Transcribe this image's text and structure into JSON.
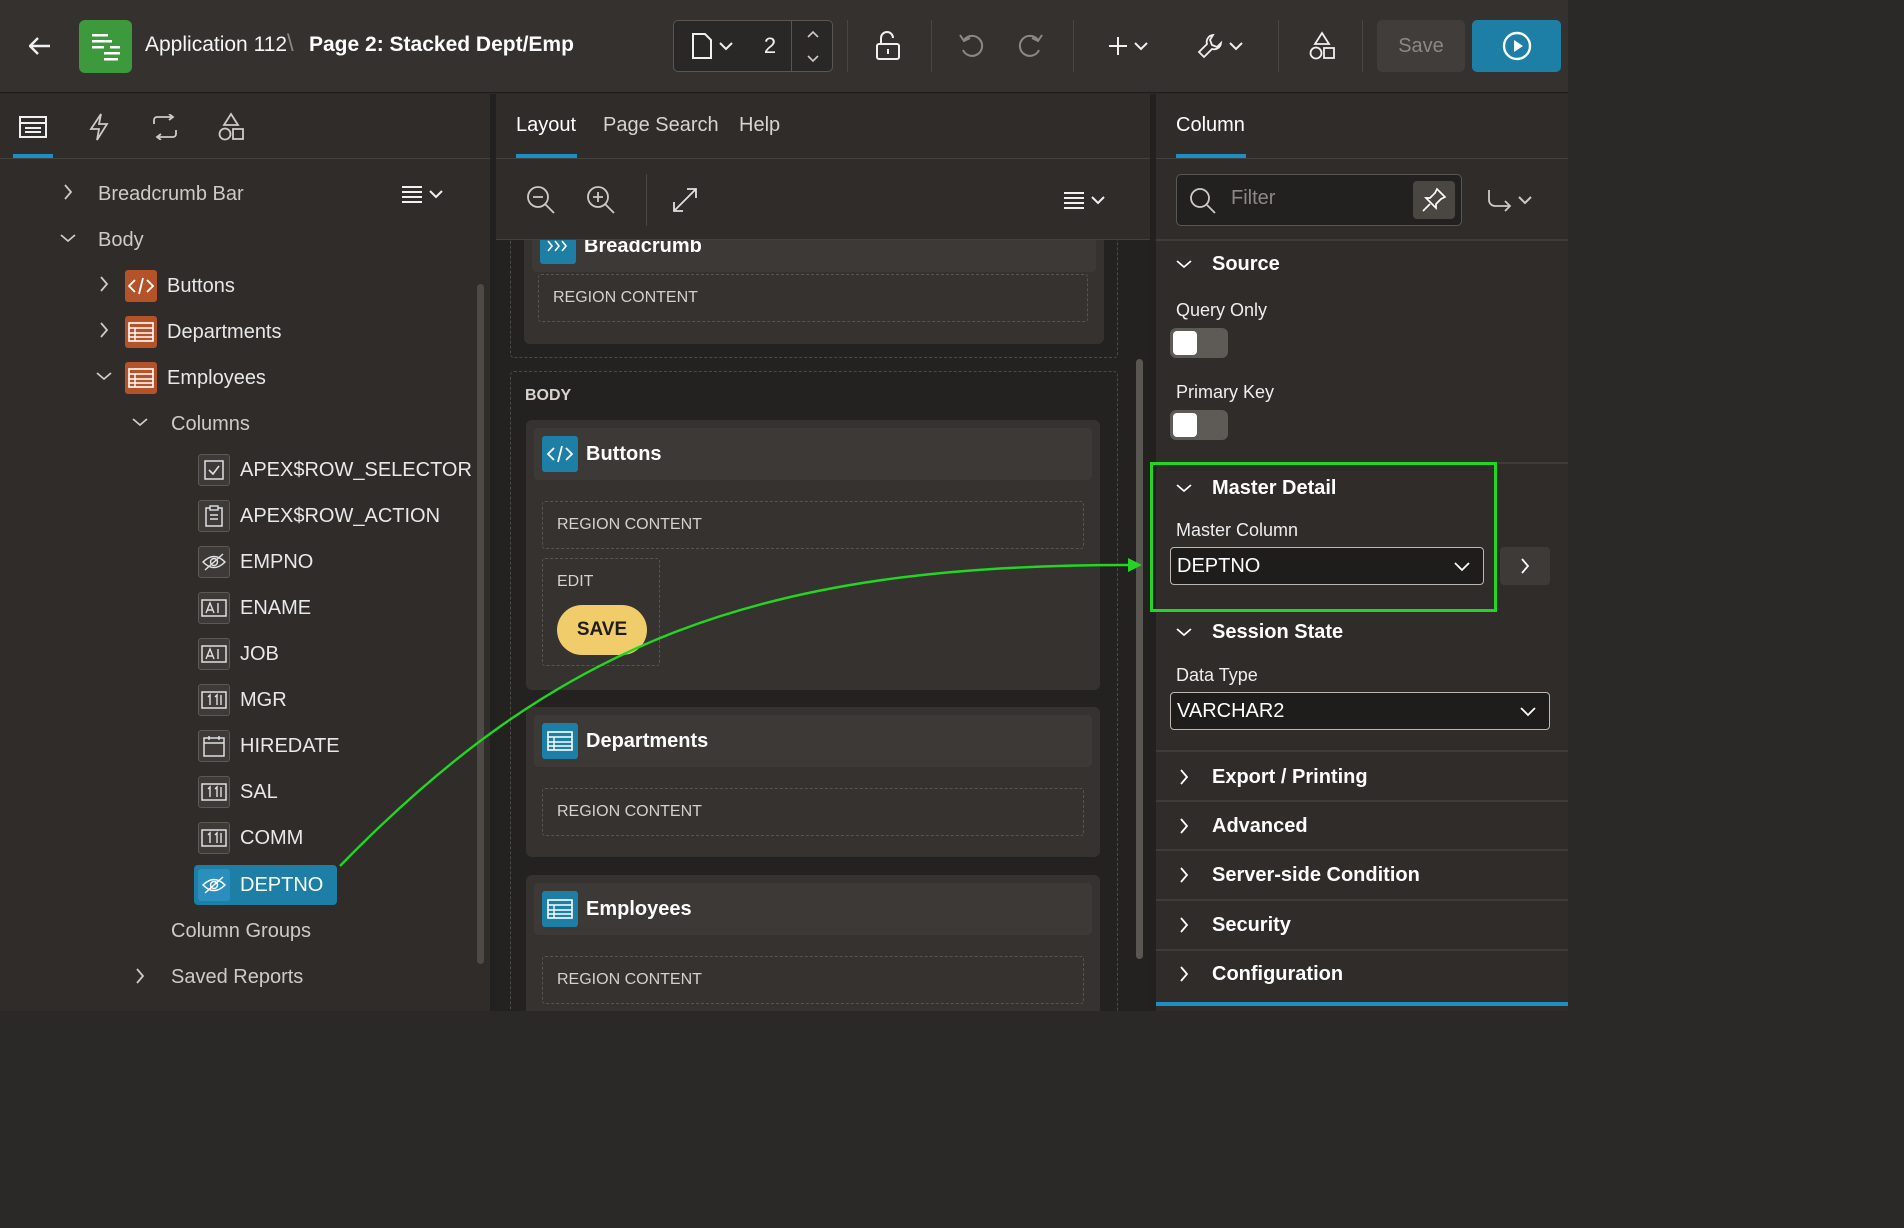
{
  "header": {
    "app_name": "Application 112",
    "crumb_separator": "\\",
    "page_name": "Page 2: Stacked Dept/Emp",
    "page_number": "2",
    "save_label": "Save"
  },
  "left_panel": {
    "tree": {
      "breadcrumb_bar": "Breadcrumb Bar",
      "body": "Body",
      "buttons": "Buttons",
      "departments": "Departments",
      "employees": "Employees",
      "columns": "Columns",
      "column_items": [
        {
          "label": "APEX$ROW_SELECTOR",
          "icon": "checkbox-icon"
        },
        {
          "label": "APEX$ROW_ACTION",
          "icon": "clipboard-icon"
        },
        {
          "label": "EMPNO",
          "icon": "hidden-eye-icon"
        },
        {
          "label": "ENAME",
          "icon": "text-field-icon"
        },
        {
          "label": "JOB",
          "icon": "text-field-icon"
        },
        {
          "label": "MGR",
          "icon": "number-field-icon"
        },
        {
          "label": "HIREDATE",
          "icon": "calendar-icon"
        },
        {
          "label": "SAL",
          "icon": "number-field-icon"
        },
        {
          "label": "COMM",
          "icon": "number-field-icon"
        },
        {
          "label": "DEPTNO",
          "icon": "hidden-eye-icon",
          "selected": true
        }
      ],
      "column_groups": "Column Groups",
      "saved_reports": "Saved Reports"
    }
  },
  "middle_panel": {
    "tabs": [
      "Layout",
      "Page Search",
      "Help"
    ],
    "canvas": {
      "breadcrumb_partial": "Breadcrumb",
      "region_content": "REGION CONTENT",
      "body_label": "BODY",
      "buttons_region": "Buttons",
      "edit_label": "EDIT",
      "save_button": "SAVE",
      "departments_region": "Departments",
      "employees_region": "Employees"
    }
  },
  "right_panel": {
    "tab": "Column",
    "filter_placeholder": "Filter",
    "sections": {
      "source": "Source",
      "master_detail": "Master Detail",
      "session_state": "Session State",
      "export_printing": "Export / Printing",
      "advanced": "Advanced",
      "server_side_condition": "Server-side Condition",
      "security": "Security",
      "configuration": "Configuration"
    },
    "props": {
      "query_only": "Query Only",
      "primary_key": "Primary Key",
      "master_column": "Master Column",
      "master_column_value": "DEPTNO",
      "data_type": "Data Type",
      "data_type_value": "VARCHAR2"
    }
  },
  "colors": {
    "accent": "#1d8fc5",
    "highlight": "#22d622",
    "save_pill": "#f0cc6b",
    "app_icon": "#3c9a3c"
  }
}
